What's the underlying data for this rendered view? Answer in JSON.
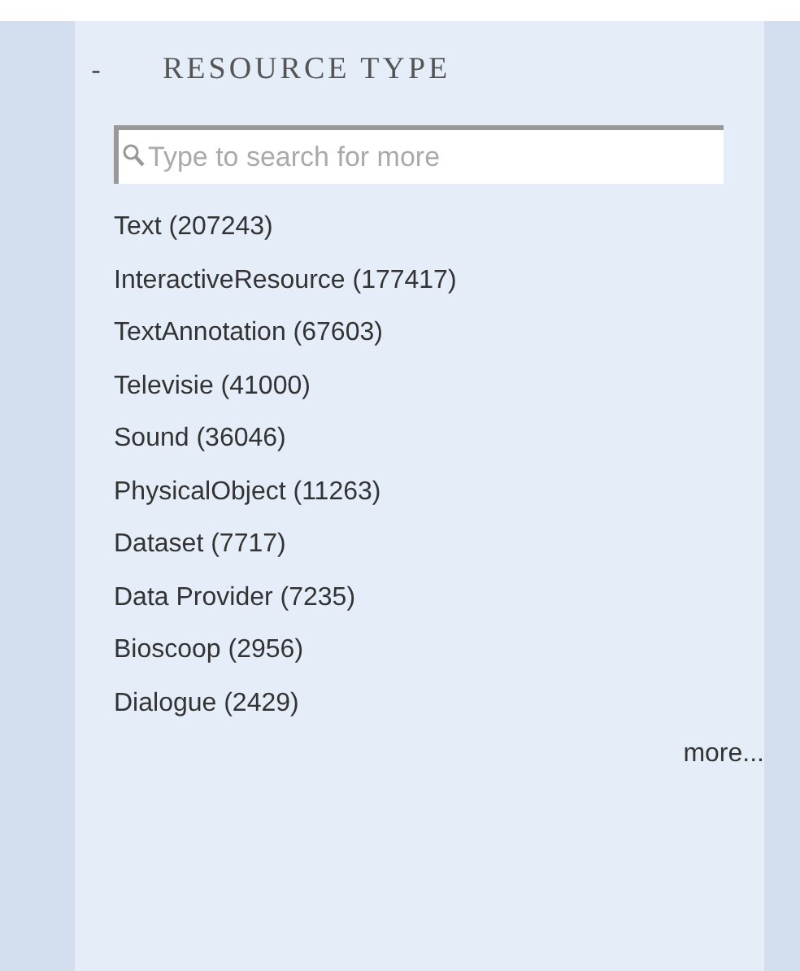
{
  "facet": {
    "collapse_symbol": "-",
    "title": "RESOURCE TYPE"
  },
  "search": {
    "placeholder": "Type to search for more"
  },
  "items": [
    {
      "label": "Text (207243)"
    },
    {
      "label": "InteractiveResource (177417)"
    },
    {
      "label": "TextAnnotation (67603)"
    },
    {
      "label": "Televisie (41000)"
    },
    {
      "label": "Sound (36046)"
    },
    {
      "label": "PhysicalObject (11263)"
    },
    {
      "label": "Dataset (7717)"
    },
    {
      "label": "Data Provider (7235)"
    },
    {
      "label": "Bioscoop (2956)"
    },
    {
      "label": "Dialogue (2429)"
    }
  ],
  "more_link": "more..."
}
